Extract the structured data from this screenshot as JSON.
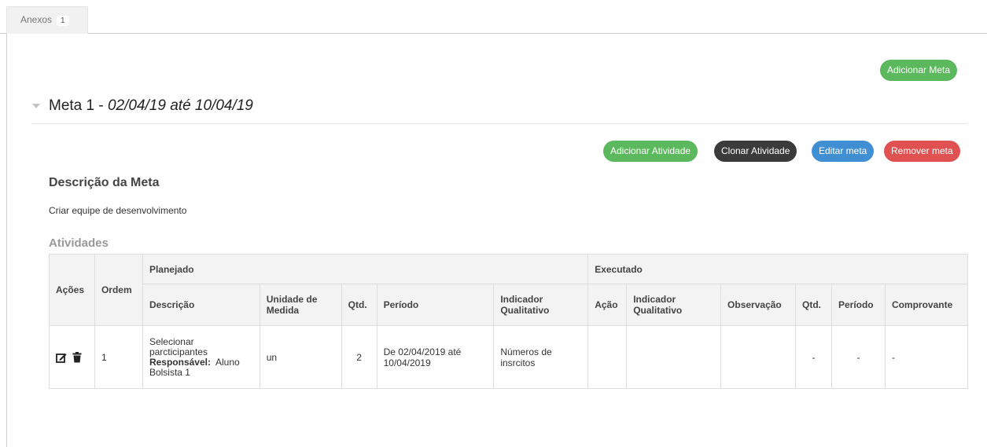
{
  "tabs": [
    {
      "label": "Anexos",
      "badge": "1"
    }
  ],
  "actions": {
    "add_meta": "Adicionar Meta",
    "add_activity": "Adicionar Atividade",
    "clone_activity": "Clonar Atividade",
    "edit_meta": "Editar meta",
    "remove_meta": "Remover meta"
  },
  "meta": {
    "title": "Meta 1",
    "separator": " - ",
    "dates": "02/04/19 até 10/04/19",
    "description_heading": "Descrição da Meta",
    "description": "Criar equipe de desenvolvimento"
  },
  "activities": {
    "heading": "Atividades",
    "headers": {
      "acoes": "Ações",
      "ordem": "Ordem",
      "planejado": "Planejado",
      "executado": "Executado",
      "descricao": "Descrição",
      "unidade": "Unidade de Medida",
      "qtd": "Qtd.",
      "periodo": "Período",
      "indicador": "Indicador Qualitativo",
      "acao": "Ação",
      "indicador_exec": "Indicador Qualitativo",
      "observacao": "Observação",
      "qtd_exec": "Qtd.",
      "periodo_exec": "Período",
      "comprovante": "Comprovante"
    },
    "rows": [
      {
        "ordem": "1",
        "descricao": "Selecionar parcticipantes",
        "responsavel_label": "Responsável:",
        "responsavel": "Aluno Bolsista 1",
        "unidade": "un",
        "qtd": "2",
        "periodo": "De 02/04/2019 até 10/04/2019",
        "indicador": "Números de insrcitos",
        "acao": "",
        "indicador_exec": "",
        "observacao": "",
        "qtd_exec": "-",
        "periodo_exec": "-",
        "comprovante": "-"
      }
    ]
  },
  "icons": {
    "edit": "edit-icon",
    "delete": "trash-icon",
    "collapse": "caret-down-icon"
  }
}
